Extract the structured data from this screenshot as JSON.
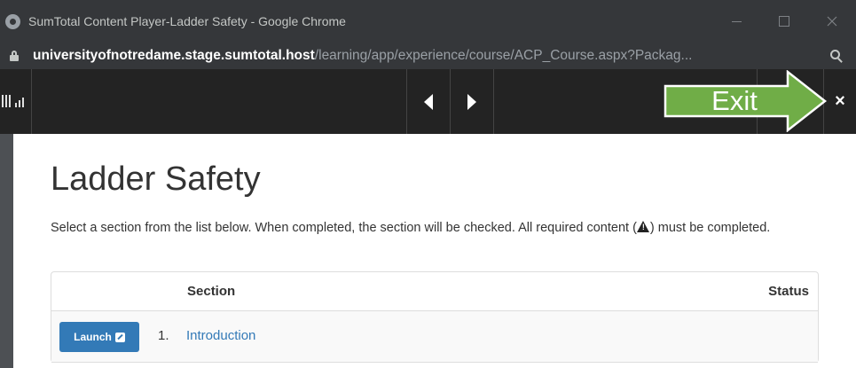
{
  "window": {
    "title": "SumTotal Content Player-Ladder Safety - Google Chrome"
  },
  "address": {
    "host": "universityofnotredame.stage.sumtotal.host",
    "path": "/learning/app/experience/course/ACP_Course.aspx?Packag..."
  },
  "player": {
    "close_label": "×"
  },
  "callout": {
    "label": "Exit",
    "color": "#70ad47"
  },
  "page": {
    "title": "Ladder Safety",
    "instructions_before": "Select a section from the list below. When completed, the section will be checked. All required content (",
    "instructions_after": ") must be completed."
  },
  "table": {
    "headers": {
      "section": "Section",
      "status": "Status"
    },
    "rows": [
      {
        "launch": "Launch",
        "number": "1.",
        "section": "Introduction",
        "status": ""
      }
    ]
  },
  "colors": {
    "link": "#337ab7",
    "launch_button": "#337ab7",
    "toolbar": "#232323"
  }
}
